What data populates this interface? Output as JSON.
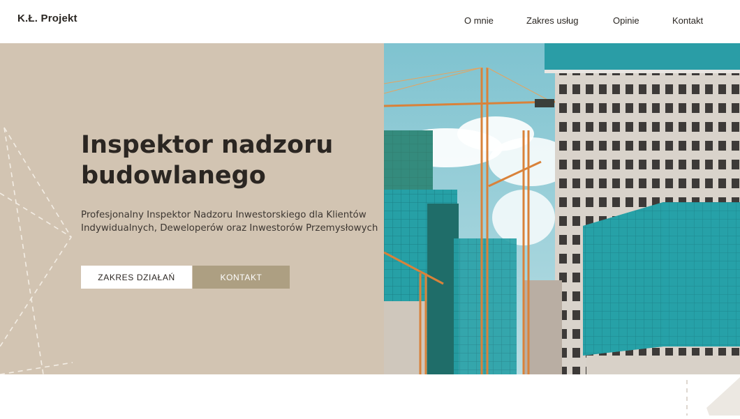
{
  "brand": {
    "logo": "K.Ł. Projekt"
  },
  "nav": {
    "items": [
      {
        "label": "O mnie"
      },
      {
        "label": "Zakres usług"
      },
      {
        "label": "Opinie"
      },
      {
        "label": "Kontakt"
      }
    ]
  },
  "hero": {
    "title": "Inspektor nadzoru budowlanego",
    "subtitle": "Profesjonalny Inspektor Nadzoru Inwestorskiego dla Klientów Indywidualnych, Deweloperów oraz Inwestorów Przemysłowych",
    "primary_button": "ZAKRES DZIAŁAŃ",
    "secondary_button": "KONTAKT",
    "image": "construction-site-photo"
  },
  "colors": {
    "hero_bg": "#d2c4b2",
    "accent": "#ad9f82",
    "text": "#2b2622",
    "glass": "#2aa3a5",
    "crane": "#d9823a"
  }
}
